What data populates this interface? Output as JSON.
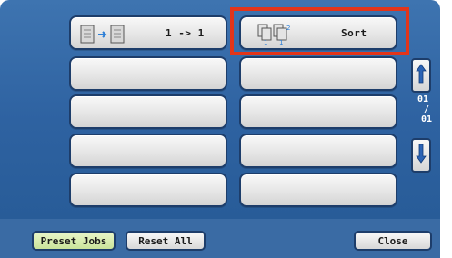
{
  "options": {
    "copy_mode_label": "1 -> 1",
    "sort_label": "Sort"
  },
  "pager": {
    "current": "01",
    "separator": "/",
    "total": "01"
  },
  "footer": {
    "preset_jobs_label": "Preset Jobs",
    "reset_all_label": "Reset All",
    "close_label": "Close"
  },
  "colors": {
    "screen_blue": "#2e62a1",
    "highlight_red": "#e2351a",
    "active_green": "#c9e39a"
  }
}
